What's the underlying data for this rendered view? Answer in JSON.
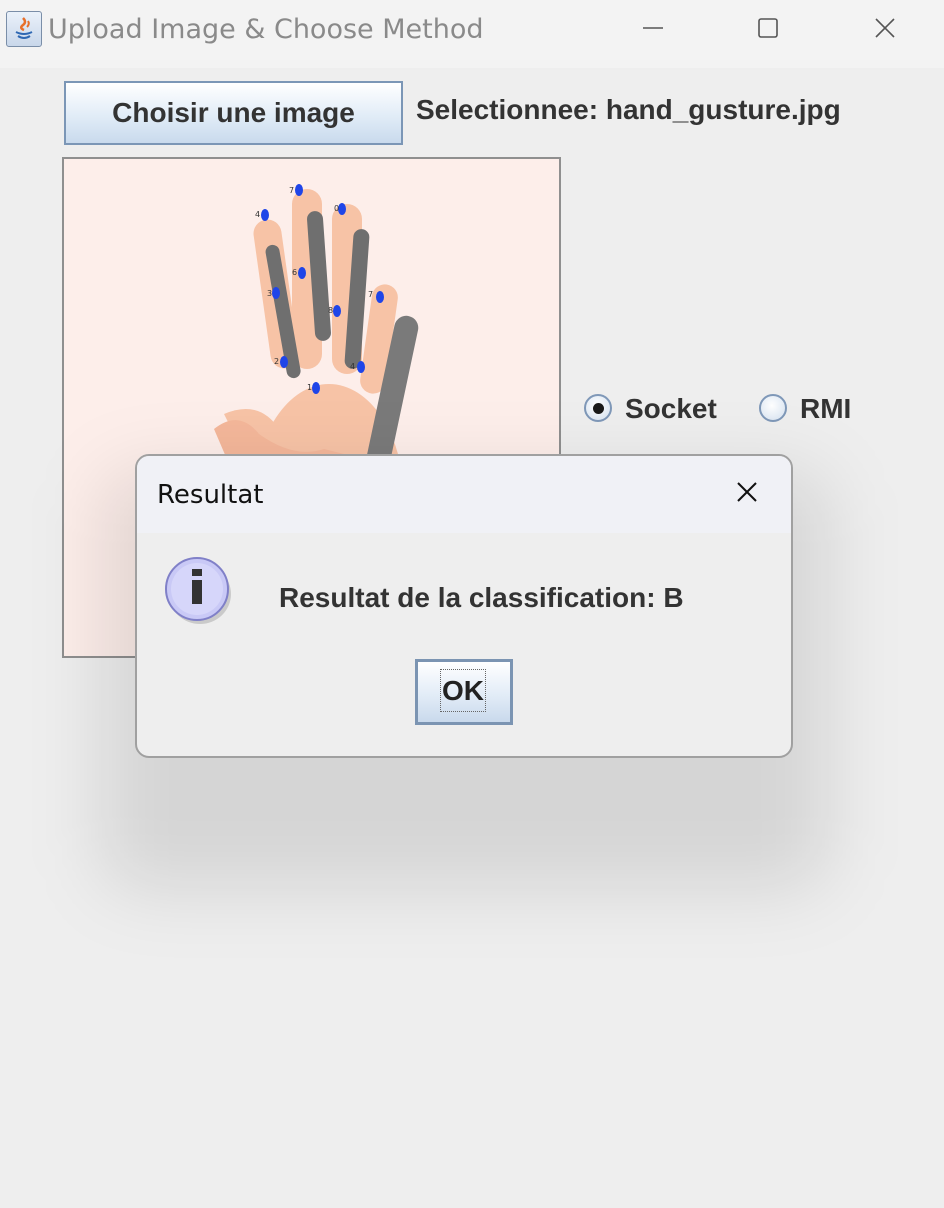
{
  "window": {
    "title": "Upload Image & Choose Method",
    "controls": [
      "minimize-icon",
      "maximize-icon",
      "close-icon"
    ]
  },
  "toolbar": {
    "choose_button_label": "Choisir une image",
    "selected_file_text": "Selectionnee: hand_gusture.jpg"
  },
  "image_preview": {
    "content": "hand-landmarks-illustration"
  },
  "method": {
    "options": [
      {
        "label": "Socket",
        "selected": true
      },
      {
        "label": "RMI",
        "selected": false
      }
    ]
  },
  "dialog": {
    "title": "Resultat",
    "icon": "info-icon",
    "message": "Resultat de la classification: B",
    "ok_label": "OK"
  },
  "colors": {
    "background": "#eeeeee",
    "button_border": "#7b96b6",
    "image_background": "#fdeeea",
    "landmark_dot": "#1f45e8"
  }
}
